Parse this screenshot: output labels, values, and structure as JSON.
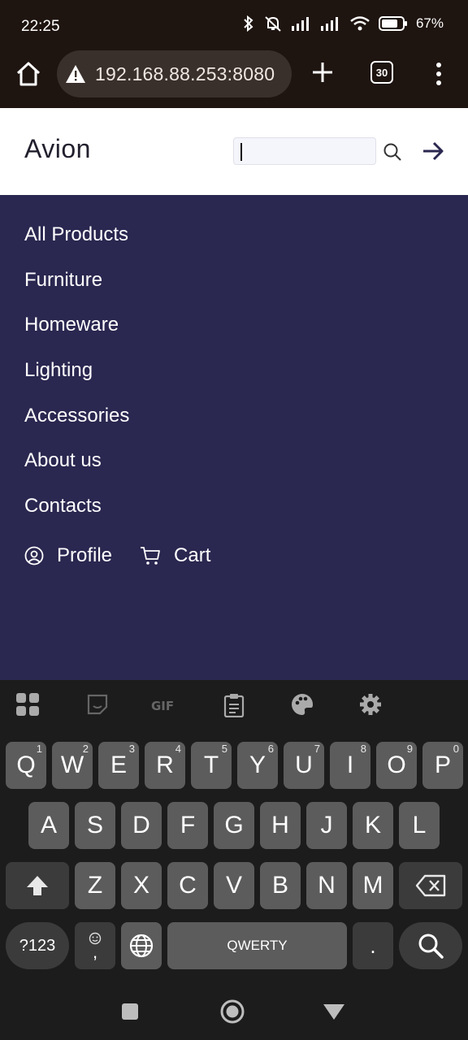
{
  "status": {
    "time": "22:25",
    "battery": "67%"
  },
  "browser": {
    "url": "192.168.88.253:8080",
    "tab_count": "30",
    "icons": [
      "home-icon",
      "warning-icon",
      "plus-icon",
      "tabs-icon",
      "kebab-menu-icon"
    ]
  },
  "header": {
    "logo": "Avion",
    "search": {
      "value": "",
      "placeholder": ""
    }
  },
  "menu": {
    "items": [
      "All Products",
      "Furniture",
      "Homeware",
      "Lighting",
      "Accessories",
      "About us",
      "Contacts"
    ],
    "profile_label": "Profile",
    "cart_label": "Cart"
  },
  "keyboard": {
    "row1": [
      {
        "k": "Q",
        "n": "1"
      },
      {
        "k": "W",
        "n": "2"
      },
      {
        "k": "E",
        "n": "3"
      },
      {
        "k": "R",
        "n": "4"
      },
      {
        "k": "T",
        "n": "5"
      },
      {
        "k": "Y",
        "n": "6"
      },
      {
        "k": "U",
        "n": "7"
      },
      {
        "k": "I",
        "n": "8"
      },
      {
        "k": "O",
        "n": "9"
      },
      {
        "k": "P",
        "n": "0"
      }
    ],
    "row2": [
      "A",
      "S",
      "D",
      "F",
      "G",
      "H",
      "J",
      "K",
      "L"
    ],
    "row3": [
      "Z",
      "X",
      "C",
      "V",
      "B",
      "N",
      "M"
    ],
    "symbols_label": "?123",
    "comma_label": ",",
    "space_label": "QWERTY",
    "period_label": "."
  },
  "colors": {
    "menu_bg": "#2a2750",
    "browser_bar": "#1e1410",
    "keyboard_bg": "#1c1c1c",
    "key": "#5c5c5c"
  }
}
